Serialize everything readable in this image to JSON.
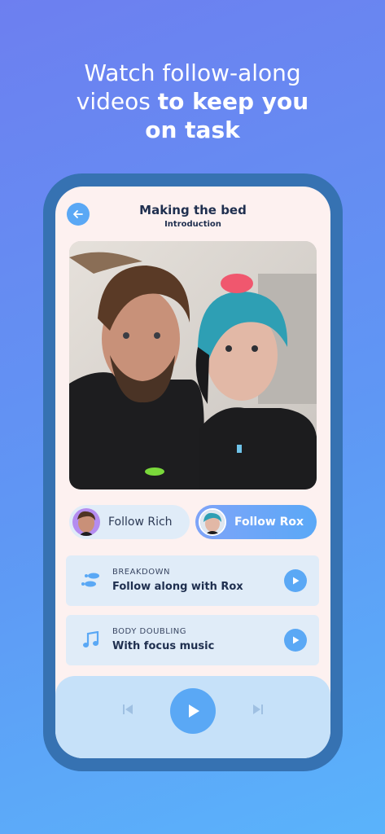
{
  "headline": {
    "line1": "Watch follow-along",
    "line2_regular": "videos",
    "line2_bold": "to keep you",
    "line3_bold": "on task"
  },
  "screen": {
    "title": "Making the bed",
    "subtitle": "Introduction"
  },
  "follow": [
    {
      "label": "Follow Rich",
      "selected": false
    },
    {
      "label": "Follow Rox",
      "selected": true
    }
  ],
  "cards": [
    {
      "kicker": "BREAKDOWN",
      "title": "Follow along with Rox",
      "icon": "footsteps-icon"
    },
    {
      "kicker": "BODY DOUBLING",
      "title": "With focus music",
      "icon": "music-note-icon"
    }
  ],
  "colors": {
    "accent": "#5aa8f5",
    "phone_frame": "#3672b2",
    "screen_bg": "#fdf1f0",
    "card_bg": "#e0ecf8",
    "player_bg": "#c6e1f9"
  }
}
